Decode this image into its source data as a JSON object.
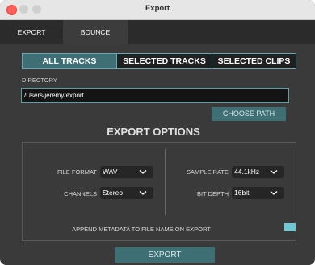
{
  "window": {
    "title": "Export"
  },
  "tabs": [
    {
      "label": "EXPORT",
      "active": true
    },
    {
      "label": "BOUNCE",
      "active": false
    }
  ],
  "track_scope": {
    "options": [
      "ALL TRACKS",
      "SELECTED TRACKS",
      "SELECTED CLIPS"
    ],
    "selected": "ALL TRACKS"
  },
  "directory": {
    "label": "DIRECTORY",
    "value": "/Users/jeremy/export",
    "choose_label": "CHOOSE PATH"
  },
  "export_options": {
    "title": "EXPORT OPTIONS",
    "file_format": {
      "label": "FILE FORMAT",
      "value": "WAV"
    },
    "channels": {
      "label": "CHANNELS",
      "value": "Stereo"
    },
    "sample_rate": {
      "label": "SAMPLE RATE",
      "value": "44.1kHz"
    },
    "bit_depth": {
      "label": "BIT DEPTH",
      "value": "16bit"
    },
    "append_metadata": {
      "label": "APPEND METADATA TO FILE NAME ON EXPORT",
      "checked": true
    }
  },
  "export_button": {
    "label": "EXPORT"
  },
  "colors": {
    "accent": "#3e6f74",
    "accent_border": "#6aa8b3",
    "checkbox": "#6fc9d2",
    "background": "#3a3a3a"
  },
  "icons": [
    "close-light",
    "minimize-light",
    "maximize-light",
    "chevron-down-icon"
  ]
}
